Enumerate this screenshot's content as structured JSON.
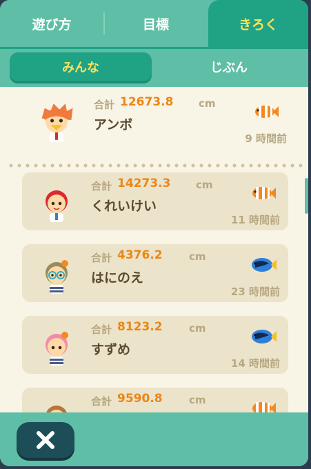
{
  "tabs": [
    {
      "label": "遊び方",
      "active": false
    },
    {
      "label": "目標",
      "active": false
    },
    {
      "label": "きろく",
      "active": true
    }
  ],
  "segments": [
    {
      "label": "みんな",
      "active": true
    },
    {
      "label": "じぶん",
      "active": false
    }
  ],
  "labels": {
    "total": "合計",
    "unit": "cm"
  },
  "my_record": {
    "distance": "12673.8",
    "name": "アンボ",
    "ago": "9 時間前",
    "fish": "clownfish-icon"
  },
  "records": [
    {
      "distance": "14273.3",
      "name": "くれいけい",
      "ago": "11 時間前",
      "fish": "clownfish-icon"
    },
    {
      "distance": "4376.2",
      "name": "はにのえ",
      "ago": "23 時間前",
      "fish": "blue-tang-icon"
    },
    {
      "distance": "8123.2",
      "name": "すずめ",
      "ago": "14 時間前",
      "fish": "blue-tang-icon"
    },
    {
      "distance": "9590.8",
      "name": "",
      "ago": "",
      "fish": "clownfish-icon"
    }
  ],
  "colors": {
    "tab_bg": "#5ebfa6",
    "active_tab": "#20a284",
    "active_text": "#ffe25a",
    "distance": "#ea8717",
    "row_bg": "#ece3cb",
    "close_button": "#1d4e58"
  },
  "footer": {
    "close_icon": "close-icon"
  }
}
